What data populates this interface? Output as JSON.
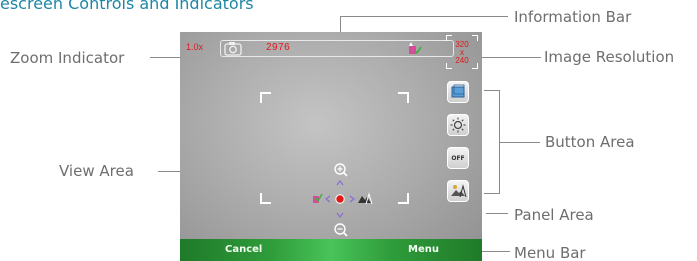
{
  "heading": "escreen Controls and Indicators",
  "callouts": {
    "zoom_indicator": "Zoom Indicator",
    "view_area": "View Area",
    "information_bar": "Information Bar",
    "image_resolution": "Image Resolution",
    "button_area": "Button Area",
    "panel_area": "Panel Area",
    "menu_bar": "Menu Bar"
  },
  "screen": {
    "zoom_value": "1.0x",
    "shot_count": "2976",
    "resolution_top": "320",
    "resolution_mid": "x",
    "resolution_bottom": "240",
    "panel_off_label": "OFF",
    "softkey_left": "Cancel",
    "softkey_right": "Menu"
  },
  "colors": {
    "heading": "#1f86a6",
    "callout_text": "#6e6e6e",
    "indicator_red": "#e01818",
    "menu_green": "#2f9c3a"
  }
}
